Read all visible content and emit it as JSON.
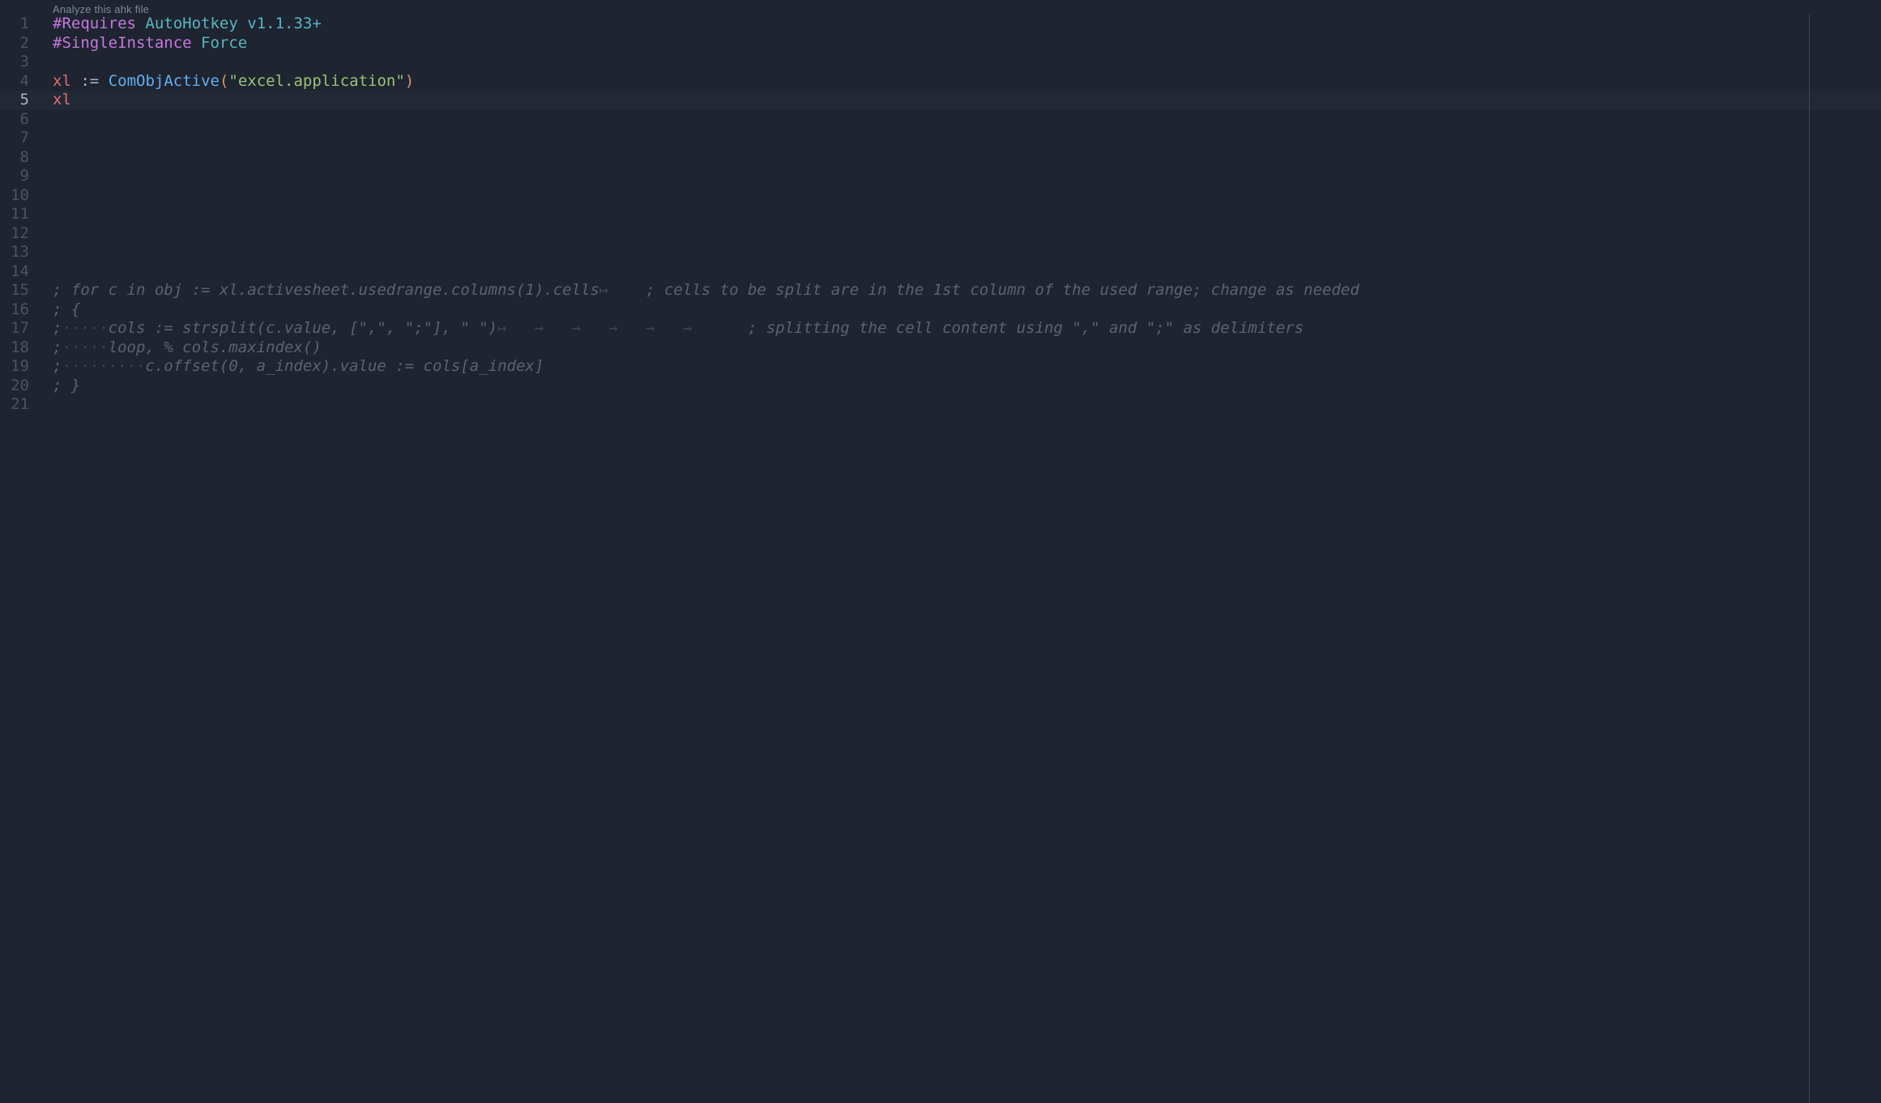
{
  "codelens": "Analyze this ahk file",
  "active_line": 5,
  "lines": [
    {
      "n": 1,
      "tokens": [
        {
          "cls": "c-directive",
          "t": "#Requires"
        },
        {
          "cls": "c-plain",
          "t": " "
        },
        {
          "cls": "c-keyword",
          "t": "AutoHotkey"
        },
        {
          "cls": "c-plain",
          "t": " "
        },
        {
          "cls": "c-keyword",
          "t": "v1.1.33+"
        }
      ]
    },
    {
      "n": 2,
      "tokens": [
        {
          "cls": "c-directive",
          "t": "#SingleInstance"
        },
        {
          "cls": "c-plain",
          "t": " "
        },
        {
          "cls": "c-keyword",
          "t": "Force"
        }
      ]
    },
    {
      "n": 3,
      "tokens": []
    },
    {
      "n": 4,
      "tokens": [
        {
          "cls": "c-var",
          "t": "xl"
        },
        {
          "cls": "c-plain",
          "t": " "
        },
        {
          "cls": "c-op",
          "t": ":="
        },
        {
          "cls": "c-plain",
          "t": " "
        },
        {
          "cls": "c-func",
          "t": "ComObjActive"
        },
        {
          "cls": "c-paren",
          "t": "("
        },
        {
          "cls": "c-str",
          "t": "\"excel.application\""
        },
        {
          "cls": "c-paren",
          "t": ")"
        }
      ]
    },
    {
      "n": 5,
      "tokens": [
        {
          "cls": "c-var",
          "t": "xl"
        }
      ]
    },
    {
      "n": 6,
      "tokens": []
    },
    {
      "n": 7,
      "tokens": []
    },
    {
      "n": 8,
      "tokens": []
    },
    {
      "n": 9,
      "tokens": []
    },
    {
      "n": 10,
      "tokens": []
    },
    {
      "n": 11,
      "tokens": []
    },
    {
      "n": 12,
      "tokens": []
    },
    {
      "n": 13,
      "tokens": []
    },
    {
      "n": 14,
      "tokens": []
    },
    {
      "n": 15,
      "tokens": [
        {
          "cls": "c-comment",
          "t": "; for c in obj := xl.activesheet.usedrange.columns(1).cells"
        },
        {
          "cls": "ws-arr",
          "t": "↦"
        },
        {
          "cls": "c-comment",
          "t": "    ; cells to be split are in the 1st column of the used range; change as needed"
        }
      ]
    },
    {
      "n": 16,
      "tokens": [
        {
          "cls": "c-comment",
          "t": "; {"
        }
      ]
    },
    {
      "n": 17,
      "tokens": [
        {
          "cls": "c-comment",
          "t": ";"
        },
        {
          "cls": "ws-dot",
          "t": "·····"
        },
        {
          "cls": "c-comment",
          "t": "cols := strsplit(c.value, [\",\", \";\"], \" \")"
        },
        {
          "cls": "ws-arr",
          "t": "↦   →   →   →   →   →   "
        },
        {
          "cls": "c-comment",
          "t": "   ; splitting the cell content using \",\" and \";\" as delimiters"
        }
      ]
    },
    {
      "n": 18,
      "tokens": [
        {
          "cls": "c-comment",
          "t": ";"
        },
        {
          "cls": "ws-dot",
          "t": "·····"
        },
        {
          "cls": "c-comment",
          "t": "loop, % cols.maxindex()"
        }
      ]
    },
    {
      "n": 19,
      "tokens": [
        {
          "cls": "c-comment",
          "t": ";"
        },
        {
          "cls": "ws-dot",
          "t": "·········"
        },
        {
          "cls": "c-comment",
          "t": "c.offset(0, a_index).value := cols[a_index]"
        }
      ]
    },
    {
      "n": 20,
      "tokens": [
        {
          "cls": "c-comment",
          "t": "; }"
        }
      ]
    },
    {
      "n": 21,
      "tokens": []
    }
  ]
}
